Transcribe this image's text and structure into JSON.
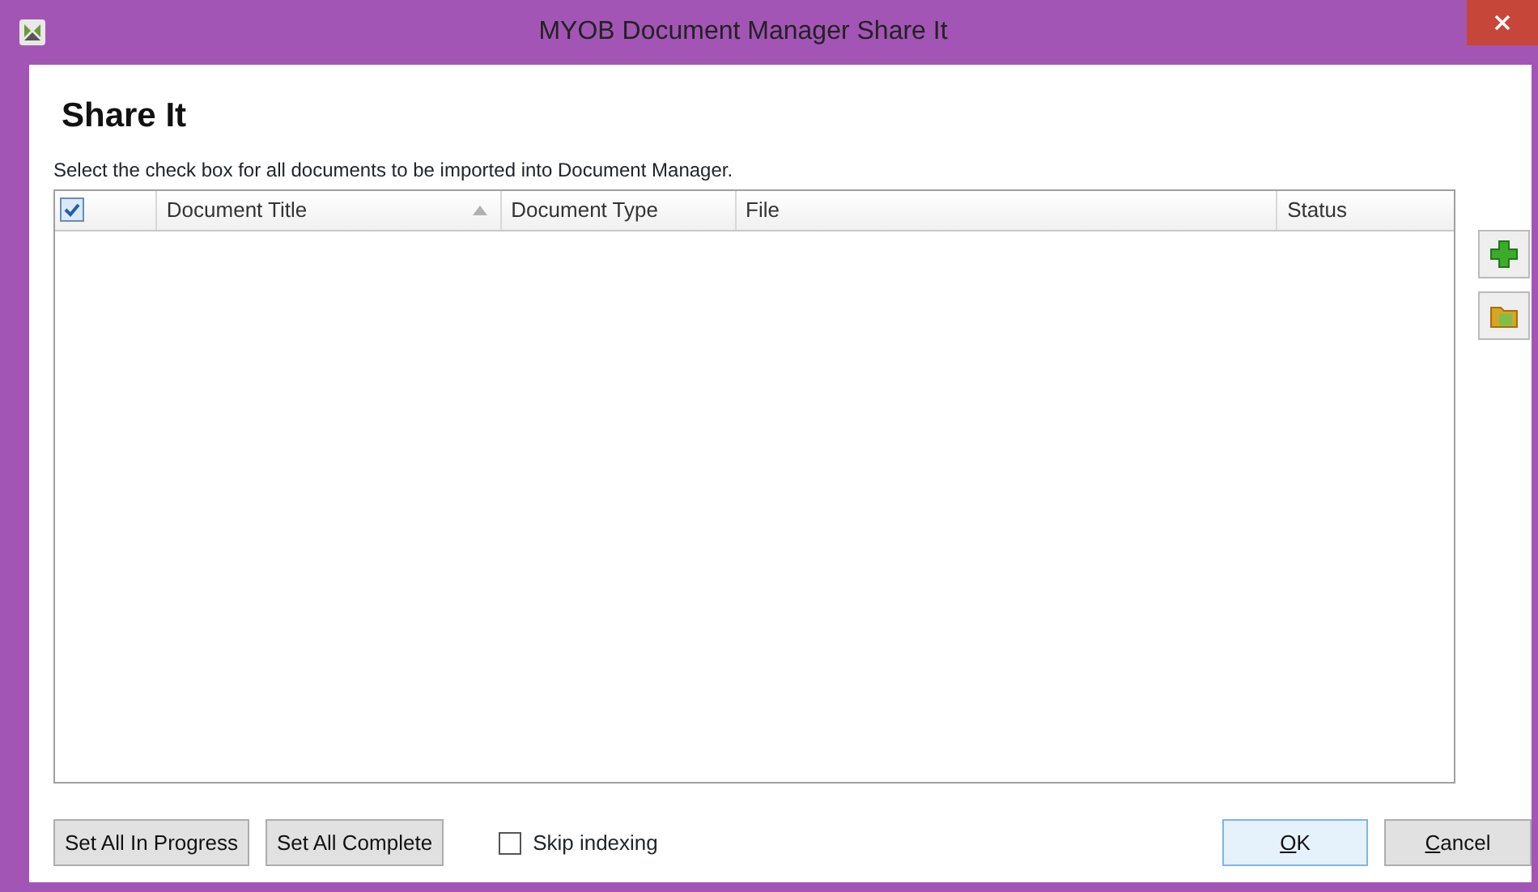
{
  "window": {
    "title": "MYOB Document Manager Share It"
  },
  "heading": "Share It",
  "instruction": "Select the check box for all documents to be imported into Document Manager.",
  "table": {
    "select_all": {
      "checked": true
    },
    "columns": [
      {
        "label": "Document Title",
        "sorted": true
      },
      {
        "label": "Document Type",
        "sorted": false
      },
      {
        "label": "File",
        "sorted": false
      },
      {
        "label": "Status",
        "sorted": false
      }
    ]
  },
  "side_buttons": [
    {
      "kind": "add"
    },
    {
      "kind": "import"
    }
  ],
  "footer": {
    "buttons": [
      {
        "label": "Set All In Progress"
      },
      {
        "label": "Set All Complete"
      }
    ],
    "skip_indexing": {
      "label": "Skip indexing",
      "checked": false
    }
  },
  "dialog_buttons": [
    {
      "label": "OK",
      "default": true,
      "underline_first": true
    },
    {
      "label": "Cancel",
      "default": false,
      "underline_first": true
    }
  ]
}
